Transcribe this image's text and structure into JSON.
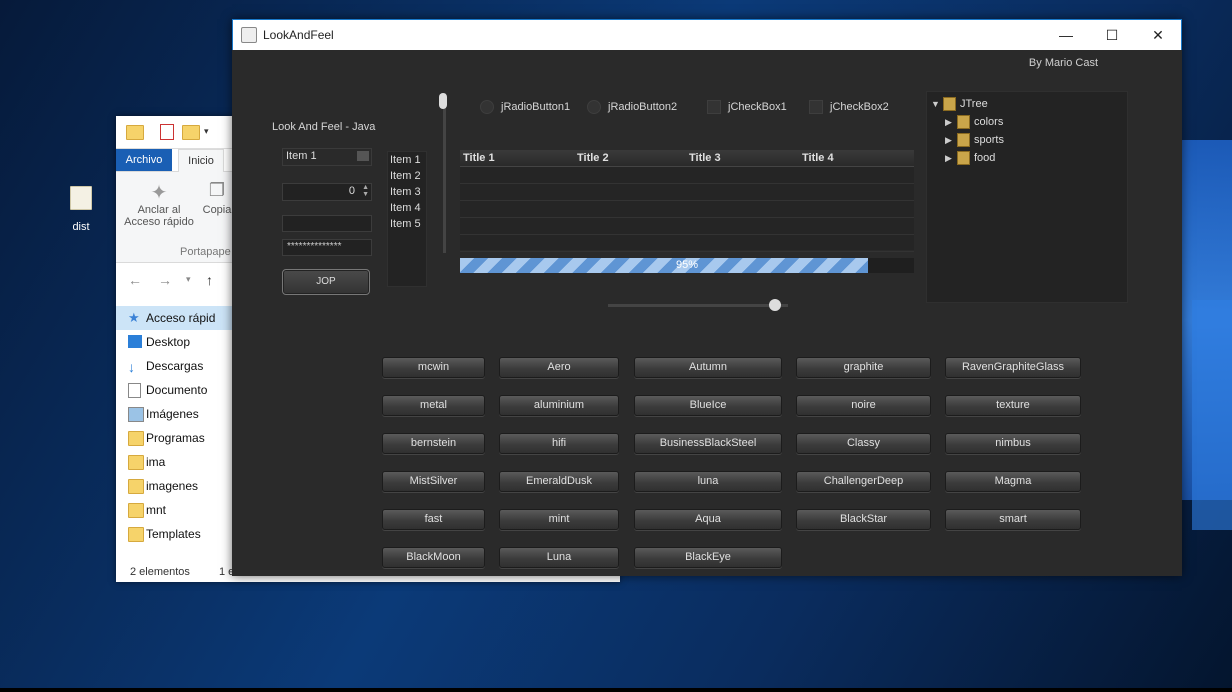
{
  "desktop": {
    "icon_label": "dist"
  },
  "explorer": {
    "tabs": [
      "Archivo",
      "Inicio"
    ],
    "ribbon": {
      "pin_label_1": "Anclar al",
      "pin_label_2": "Acceso rápido",
      "copy_label": "Copia",
      "group_label": "Portapape"
    },
    "sidebar": [
      "Acceso rápid",
      "Desktop",
      "Descargas",
      "Documento",
      "Imágenes",
      "Programas",
      "ima",
      "imagenes",
      "mnt",
      "Templates"
    ],
    "status_count": "2 elementos",
    "status_selected": "1 e"
  },
  "app": {
    "title": "LookAndFeel",
    "credit": "By Mario Cast",
    "label": "Look And Feel - Java",
    "combo_value": "Item 1",
    "spinner_value": "0",
    "password_mask": "**************",
    "jop_label": "JOP",
    "list_items": [
      "Item 1",
      "Item 2",
      "Item 3",
      "Item 4",
      "Item 5"
    ],
    "radio_1": "jRadioButton1",
    "radio_2": "jRadioButton2",
    "check_1": "jCheckBox1",
    "check_2": "jCheckBox2",
    "table_headers": [
      "Title 1",
      "Title 2",
      "Title 3",
      "Title 4"
    ],
    "progress_text": "95%",
    "progress_value": 0.95,
    "slider_value": 0.93,
    "tree": {
      "root": "JTree",
      "children": [
        "colors",
        "sports",
        "food"
      ]
    },
    "laf_buttons": [
      [
        "mcwin",
        "Aero",
        "Autumn",
        "graphite",
        "RavenGraphiteGlass"
      ],
      [
        "metal",
        "aluminium",
        "BlueIce",
        "noire",
        "texture"
      ],
      [
        "bernstein",
        "hifi",
        "BusinessBlackSteel",
        "Classy",
        "nimbus"
      ],
      [
        "MistSilver",
        "EmeraldDusk",
        "luna",
        "ChallengerDeep",
        "Magma"
      ],
      [
        "fast",
        "mint",
        "Aqua",
        "BlackStar",
        "smart"
      ],
      [
        "BlackMoon",
        "Luna",
        "BlackEye"
      ]
    ]
  }
}
